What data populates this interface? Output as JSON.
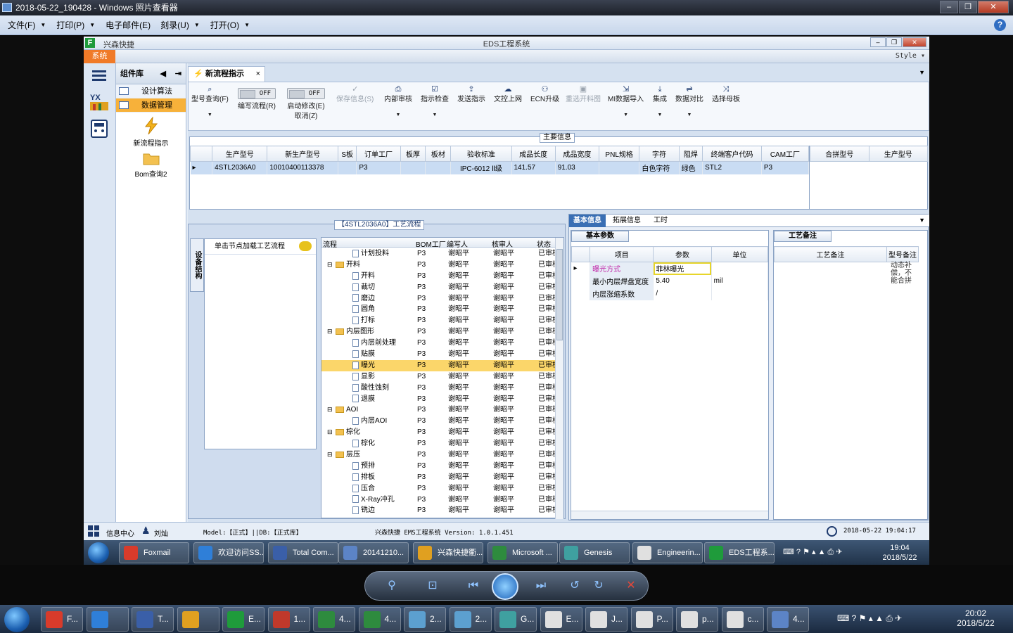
{
  "viewer": {
    "title": "2018-05-22_190428 - Windows 照片查看器",
    "menu": [
      "文件(F)",
      "打印(P)",
      "电子邮件(E)",
      "刻录(U)",
      "打开(O)"
    ],
    "help": "?"
  },
  "eds": {
    "title": "EDS工程系统",
    "brand": "兴森快捷",
    "system_tab": "系统",
    "style": "Style",
    "nav_panel": {
      "title": "组件库",
      "items": [
        "设计算法",
        "数据管理"
      ],
      "tiles": [
        "新流程指示",
        "Bom查询2"
      ]
    },
    "doc_tab": "新流程指示",
    "toolbar": [
      {
        "label": "型号查询(F)",
        "icon": "search-icon"
      },
      {
        "label": "编写流程(R)",
        "toggle": "OFF"
      },
      {
        "label": "启动修改(E)",
        "label2": "取消(Z)",
        "toggle": "OFF"
      },
      {
        "label": "保存信息(S)",
        "icon": "check-icon",
        "disabled": true
      },
      {
        "label": "内部审核",
        "icon": "print-icon"
      },
      {
        "label": "指示检查",
        "icon": "check-box-icon"
      },
      {
        "label": "发送指示",
        "icon": "upload-icon"
      },
      {
        "label": "文控上网",
        "icon": "cloud-upload-icon"
      },
      {
        "label": "ECN升级",
        "icon": "users-icon"
      },
      {
        "label": "重选开料图",
        "icon": "image-icon",
        "disabled": true
      },
      {
        "label": "MI数据导入",
        "icon": "import-icon"
      },
      {
        "label": "集成",
        "icon": "download-icon"
      },
      {
        "label": "数据对比",
        "icon": "compare-icon"
      },
      {
        "label": "选择母板",
        "icon": "shuffle-icon"
      }
    ],
    "main_info": {
      "label": "主要信息",
      "columns": [
        "生产型号",
        "新生产型号",
        "S板",
        "订单工厂",
        "板厚",
        "板材",
        "验收标准",
        "成品长度",
        "成品宽度",
        "PNL规格",
        "字符",
        "阻焊",
        "终端客户代码",
        "CAM工厂"
      ],
      "row": [
        "4STL2036A0",
        "10010400113378",
        "",
        "P3",
        "",
        "",
        "IPC-6012 Ⅱ级",
        "141.57",
        "91.03",
        "",
        "白色字符",
        "绿色",
        "STL2",
        "P3"
      ],
      "side_columns": [
        "合拼型号",
        "生产型号"
      ]
    },
    "process": {
      "label": "【4STL2036A0】工艺流程",
      "side_tab": "设备结构",
      "hint": "单击节点加载工艺流程",
      "columns": [
        "流程",
        "BOM工厂",
        "编写人",
        "核审人",
        "状态"
      ],
      "rows": [
        {
          "name": "计划投料",
          "level": 2,
          "factory": "P3",
          "writer": "谢昭平",
          "reviewer": "谢昭平",
          "status": "已审核"
        },
        {
          "name": "开料",
          "level": 1,
          "factory": "P3",
          "writer": "谢昭平",
          "reviewer": "谢昭平",
          "status": "已审核"
        },
        {
          "name": "开料",
          "level": 2,
          "factory": "P3",
          "writer": "谢昭平",
          "reviewer": "谢昭平",
          "status": "已审核"
        },
        {
          "name": "裁切",
          "level": 2,
          "factory": "P3",
          "writer": "谢昭平",
          "reviewer": "谢昭平",
          "status": "已审核"
        },
        {
          "name": "磨边",
          "level": 2,
          "factory": "P3",
          "writer": "谢昭平",
          "reviewer": "谢昭平",
          "status": "已审核"
        },
        {
          "name": "圆角",
          "level": 2,
          "factory": "P3",
          "writer": "谢昭平",
          "reviewer": "谢昭平",
          "status": "已审核"
        },
        {
          "name": "打标",
          "level": 2,
          "factory": "P3",
          "writer": "谢昭平",
          "reviewer": "谢昭平",
          "status": "已审核"
        },
        {
          "name": "内层图形",
          "level": 1,
          "factory": "P3",
          "writer": "谢昭平",
          "reviewer": "谢昭平",
          "status": "已审核"
        },
        {
          "name": "内层前处理",
          "level": 2,
          "factory": "P3",
          "writer": "谢昭平",
          "reviewer": "谢昭平",
          "status": "已审核"
        },
        {
          "name": "贴膜",
          "level": 2,
          "factory": "P3",
          "writer": "谢昭平",
          "reviewer": "谢昭平",
          "status": "已审核"
        },
        {
          "name": "曝光",
          "level": 2,
          "factory": "P3",
          "writer": "谢昭平",
          "reviewer": "谢昭平",
          "status": "已审核",
          "selected": true
        },
        {
          "name": "显影",
          "level": 2,
          "factory": "P3",
          "writer": "谢昭平",
          "reviewer": "谢昭平",
          "status": "已审核"
        },
        {
          "name": "酸性蚀刻",
          "level": 2,
          "factory": "P3",
          "writer": "谢昭平",
          "reviewer": "谢昭平",
          "status": "已审核"
        },
        {
          "name": "退膜",
          "level": 2,
          "factory": "P3",
          "writer": "谢昭平",
          "reviewer": "谢昭平",
          "status": "已审核"
        },
        {
          "name": "AOI",
          "level": 1,
          "factory": "P3",
          "writer": "谢昭平",
          "reviewer": "谢昭平",
          "status": "已审核"
        },
        {
          "name": "内层AOI",
          "level": 2,
          "factory": "P3",
          "writer": "谢昭平",
          "reviewer": "谢昭平",
          "status": "已审核"
        },
        {
          "name": "棕化",
          "level": 1,
          "factory": "P3",
          "writer": "谢昭平",
          "reviewer": "谢昭平",
          "status": "已审核"
        },
        {
          "name": "棕化",
          "level": 2,
          "factory": "P3",
          "writer": "谢昭平",
          "reviewer": "谢昭平",
          "status": "已审核"
        },
        {
          "name": "层压",
          "level": 1,
          "factory": "P3",
          "writer": "谢昭平",
          "reviewer": "谢昭平",
          "status": "已审核"
        },
        {
          "name": "预排",
          "level": 2,
          "factory": "P3",
          "writer": "谢昭平",
          "reviewer": "谢昭平",
          "status": "已审核"
        },
        {
          "name": "排板",
          "level": 2,
          "factory": "P3",
          "writer": "谢昭平",
          "reviewer": "谢昭平",
          "status": "已审核"
        },
        {
          "name": "压合",
          "level": 2,
          "factory": "P3",
          "writer": "谢昭平",
          "reviewer": "谢昭平",
          "status": "已审核"
        },
        {
          "name": "X-Ray冲孔",
          "level": 2,
          "factory": "P3",
          "writer": "谢昭平",
          "reviewer": "谢昭平",
          "status": "已审核"
        },
        {
          "name": "铣边",
          "level": 2,
          "factory": "P3",
          "writer": "谢昭平",
          "reviewer": "谢昭平",
          "status": "已审核"
        }
      ]
    },
    "detail": {
      "tabs": [
        "基本信息",
        "拓展信息",
        "工时"
      ],
      "sub_tab": "基本参数",
      "columns": [
        "项目",
        "参数",
        "单位"
      ],
      "rows": [
        {
          "item": "曝光方式",
          "param": "菲林曝光",
          "unit": ""
        },
        {
          "item": "最小内层焊盘宽度",
          "param": "5.40",
          "unit": "mil"
        },
        {
          "item": "内层涨缩系数",
          "param": "/",
          "unit": ""
        }
      ]
    },
    "notes": {
      "tab": "工艺备注",
      "columns": [
        "工艺备注",
        "型号备注"
      ],
      "model_note": "动态补偿，不能合拼"
    },
    "status": {
      "info_center": "信息中心",
      "user": "刘灿",
      "model_db": "Model:【正式】||DB:【正式库】",
      "version": "兴森快捷 EMS工程系统 Version: 1.0.1.451",
      "datetime": "2018-05-22 19:04:17"
    }
  },
  "taskbar_inner": {
    "items": [
      "Foxmail",
      "欢迎访问SS...",
      "Total Com...",
      "20141210...",
      "兴森快捷衢...",
      "Microsoft ...",
      "Genesis",
      "Engineerin...",
      "EDS工程系..."
    ],
    "time": "19:04",
    "date": "2018/5/22"
  },
  "taskbar_outer": {
    "items": [
      "F...",
      "",
      "T...",
      "",
      "E...",
      "1...",
      "4...",
      "4...",
      "2...",
      "2...",
      "G...",
      "E...",
      "J...",
      "P...",
      "p...",
      "c...",
      "4..."
    ],
    "time": "20:02",
    "date": "2018/5/22"
  }
}
